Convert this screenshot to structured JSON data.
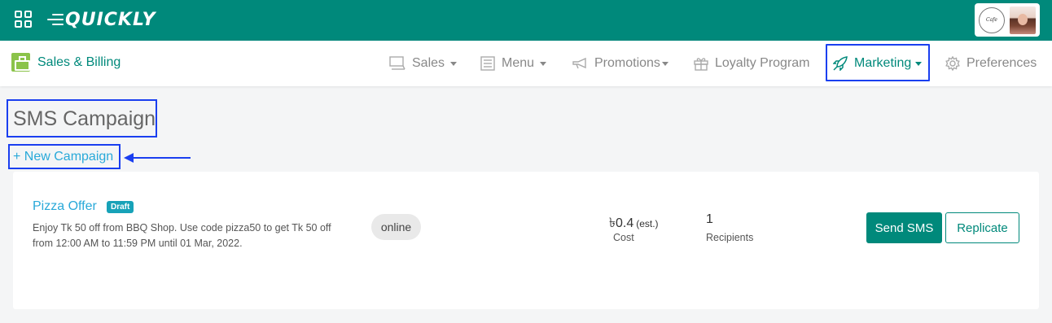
{
  "topbar": {
    "logo_text": "QUICKLY",
    "brand_logo_text": "Cafe",
    "colors": {
      "primary": "#00897b",
      "highlight": "#1a3ff0",
      "link": "#29a9d9"
    }
  },
  "app": {
    "name": "Sales & Billing",
    "icon": "register-icon"
  },
  "nav": {
    "sales": {
      "label": "Sales",
      "icon": "monitor-icon"
    },
    "menu": {
      "label": "Menu",
      "icon": "list-icon"
    },
    "promotions": {
      "label": "Promotions",
      "icon": "megaphone-icon"
    },
    "loyalty": {
      "label": "Loyalty Program",
      "icon": "gift-icon"
    },
    "marketing": {
      "label": "Marketing",
      "icon": "rocket-icon"
    },
    "preferences": {
      "label": "Preferences",
      "icon": "gear-icon"
    }
  },
  "page": {
    "title": "SMS Campaign",
    "new_campaign_label": "+ New Campaign"
  },
  "campaign": {
    "name": "Pizza Offer",
    "status": "Draft",
    "description": "Enjoy Tk 50 off from BBQ Shop. Use code pizza50 to get Tk 50 off from 12:00 AM to 11:59 PM until 01 Mar, 2022.",
    "channel": "online",
    "cost_value": "৳0.4",
    "cost_est": "(est.)",
    "cost_label": "Cost",
    "recipients_value": "1",
    "recipients_label": "Recipients",
    "send_label": "Send SMS",
    "replicate_label": "Replicate"
  }
}
